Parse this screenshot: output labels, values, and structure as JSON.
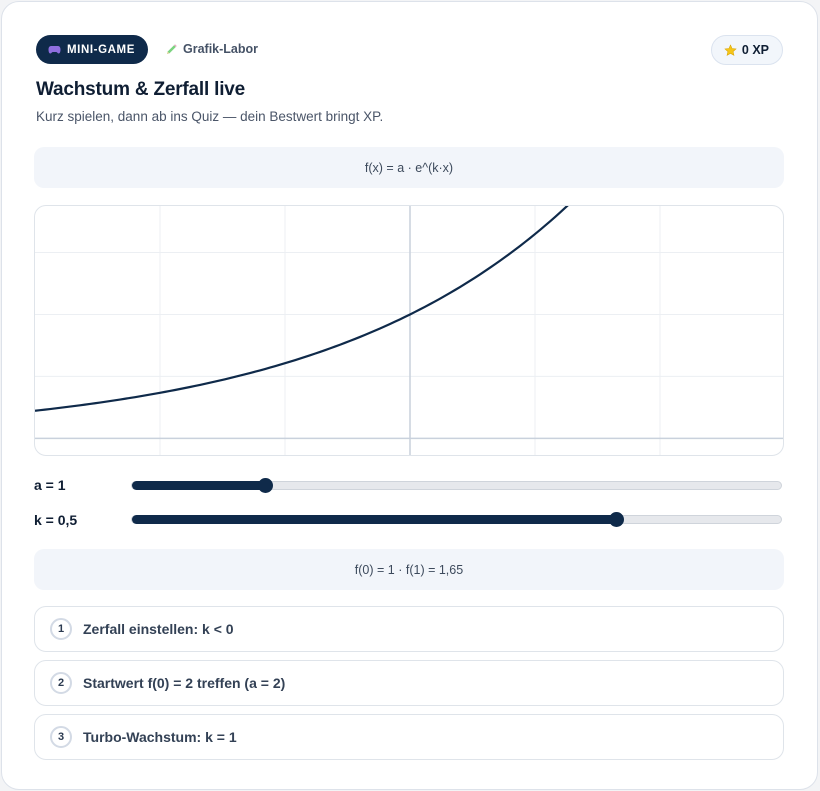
{
  "header": {
    "badge_label": "MINI-GAME",
    "lab_label": "Grafik-Labor",
    "xp_label": "0 XP",
    "title": "Wachstum & Zerfall live",
    "subtitle": "Kurz spielen, dann ab ins Quiz — dein Bestwert bringt XP."
  },
  "formula": "f(x) = a · e^(k·x)",
  "sliders": [
    {
      "label": "a = 1",
      "value": 1,
      "fill_fraction": 0.205
    },
    {
      "label": "k = 0,5",
      "value": 0.5,
      "fill_fraction": 0.746
    }
  ],
  "result": "f(0) = 1 · f(1) = 1,65",
  "tasks": [
    {
      "num": "1",
      "text": "Zerfall einstellen: k < 0"
    },
    {
      "num": "2",
      "text": "Startwert f(0) = 2 treffen (a = 2)"
    },
    {
      "num": "3",
      "text": "Turbo-Wachstum: k = 1"
    }
  ],
  "colors": {
    "primary": "#0f2a4a",
    "curve": "#0f2a4a",
    "grid": "#eceff3",
    "axis": "#c9d1dc",
    "soft_bg": "#f2f5fa"
  },
  "icons": {
    "badge_icon": "gamepad-icon",
    "lab_icon": "pencil-icon",
    "xp_icon": "star-icon"
  }
}
